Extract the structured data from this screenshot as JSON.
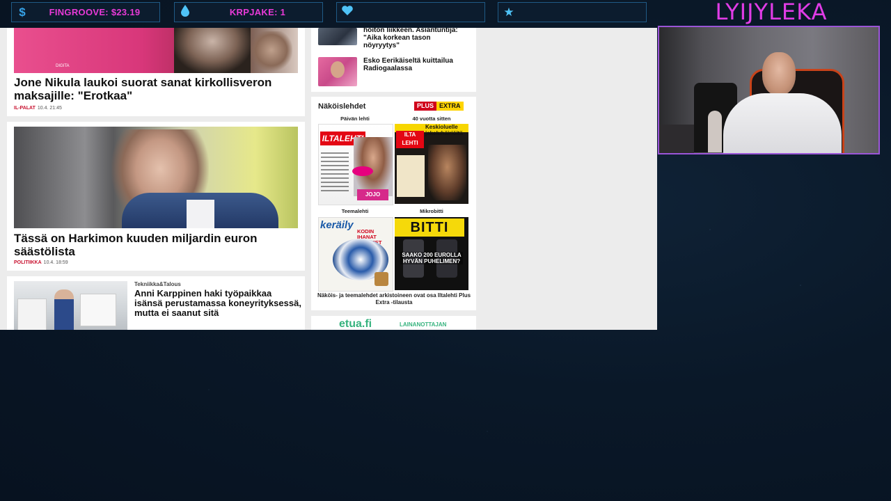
{
  "stream": {
    "name": "LYIJYLEKA",
    "stats": [
      {
        "icon": "dollar-icon",
        "glyph": "$",
        "color": "#36a3e8",
        "text": "FINGROOVE: $23.19"
      },
      {
        "icon": "droplet-icon",
        "glyph": "♦",
        "color": "#4fc3f7",
        "text": "KRPJAKE: 1"
      },
      {
        "icon": "heart-icon",
        "glyph": "♥",
        "color": "#4fc3f7",
        "text": ""
      },
      {
        "icon": "star-icon",
        "glyph": "★",
        "color": "#4fc3f7",
        "text": ""
      }
    ]
  },
  "news": {
    "article1": {
      "title": "Jone Nikula laukoi suorat sanat kirkollisveron maksajille: \"Erotkaa\"",
      "category": "IL-PALAT",
      "time": "10.4. 21:45"
    },
    "article2": {
      "title": "Tässä on Harkimon kuuden miljardin euron säästölista",
      "category": "POLITIIKKA",
      "time": "10.4. 18:59"
    },
    "article3": {
      "category": "Tekniikka&Talous",
      "title": "Anni Karppinen haki työpaikkaa isänsä perustamassa koneyrityksessä, mutta ei saanut sitä"
    },
    "side1": {
      "title": "hoiton liikkeen. Asiantuntija: \"Aika korkean tason nöyryytys\""
    },
    "side2": {
      "title": "Esko Eerikäiseltä kuittailua Radiogaalassa"
    },
    "magazines": {
      "heading": "Näköislehdet",
      "badge_plus": "PLUS",
      "badge_extra": "EXTRA",
      "label1": "Päivän lehti",
      "label2": "40 vuotta sitten",
      "label3": "Teemalehti",
      "label4": "Mikrobitti",
      "footer": "Näköis- ja teemalehdet arkistoineen ovat osa Iltalehti Plus Extra -tilausta",
      "mag1_logo": "ILTALEHTI",
      "mag2_logo": "ILTA LEHTI",
      "mag2_headline": "Keskioluelle jakeluhäiriöitä",
      "mag3_logo": "keräily",
      "mag3_headline": "KODIN IHANAT AARTEET",
      "mag4_logo": "BITTI",
      "mag4_headline": "SAAKO 200 EUROLLA HYVÄN PUHELIMEN?"
    },
    "ad": {
      "logo": "etua.fi",
      "text": "LAINANOTTAJAN"
    }
  }
}
